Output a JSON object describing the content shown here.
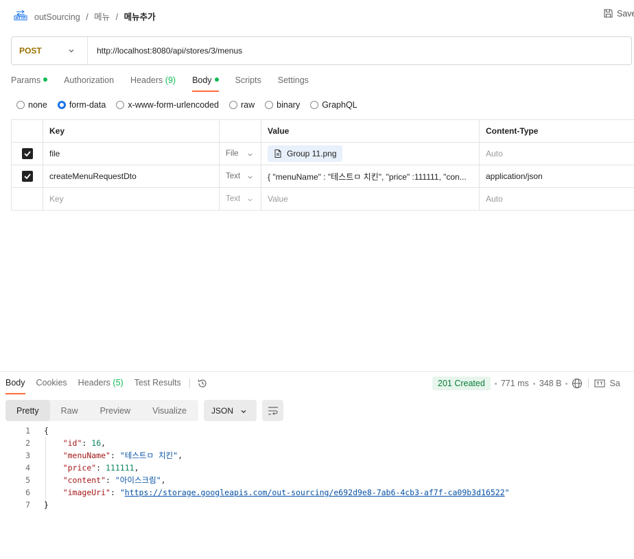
{
  "topbar": {
    "icon": "http-icon",
    "breadcrumb": [
      "outSourcing",
      "메뉴",
      "메뉴추가"
    ],
    "save_label": "Save"
  },
  "request": {
    "method": "POST",
    "url": "http://localhost:8080/api/stores/3/menus"
  },
  "request_tabs": [
    {
      "label": "Params",
      "dot": true
    },
    {
      "label": "Authorization",
      "dot": false
    },
    {
      "label": "Headers",
      "count": "(9)",
      "dot": false
    },
    {
      "label": "Body",
      "dot": true,
      "active": true
    },
    {
      "label": "Scripts",
      "dot": false
    },
    {
      "label": "Settings",
      "dot": false
    }
  ],
  "body_types": [
    {
      "label": "none",
      "checked": false
    },
    {
      "label": "form-data",
      "checked": true
    },
    {
      "label": "x-www-form-urlencoded",
      "checked": false
    },
    {
      "label": "raw",
      "checked": false
    },
    {
      "label": "binary",
      "checked": false
    },
    {
      "label": "GraphQL",
      "checked": false
    }
  ],
  "form_table": {
    "headers": {
      "key": "Key",
      "value": "Value",
      "content_type": "Content-Type"
    },
    "rows": [
      {
        "checked": true,
        "key": "file",
        "type": "File",
        "value": "Group 11.png",
        "content_type": "Auto"
      },
      {
        "checked": true,
        "key": "createMenuRequestDto",
        "type": "Text",
        "value": "{ \"menuName\" : \"테스트ㅁ 치킨\", \"price\" :111111, \"con...",
        "content_type": "application/json"
      }
    ],
    "empty_row": {
      "key": "Key",
      "type": "Text",
      "value": "Value",
      "content_type": "Auto"
    }
  },
  "response_tabs": [
    {
      "label": "Body",
      "active": true
    },
    {
      "label": "Cookies"
    },
    {
      "label": "Headers",
      "count": "(5)"
    },
    {
      "label": "Test Results"
    }
  ],
  "response_meta": {
    "status": "201 Created",
    "time": "771 ms",
    "size": "348 B",
    "save_label": "Sa"
  },
  "view_modes": [
    "Pretty",
    "Raw",
    "Preview",
    "Visualize"
  ],
  "format": "JSON",
  "response_json": {
    "id": "16",
    "menuName": "\"테스트ㅁ 치킨\"",
    "price": "111111",
    "content": "\"아이스크림\"",
    "imageUri": "https://storage.googleapis.com/out-sourcing/e692d9e8-7ab6-4cb3-af7f-ca09b3d16522"
  },
  "line_numbers": [
    "1",
    "2",
    "3",
    "4",
    "5",
    "6",
    "7"
  ],
  "colors": {
    "accent": "#ff6c37",
    "method": "#9a7100",
    "dot": "#0cbb52",
    "status_bg": "#e7f5ec",
    "radio": "#1a73e8"
  }
}
